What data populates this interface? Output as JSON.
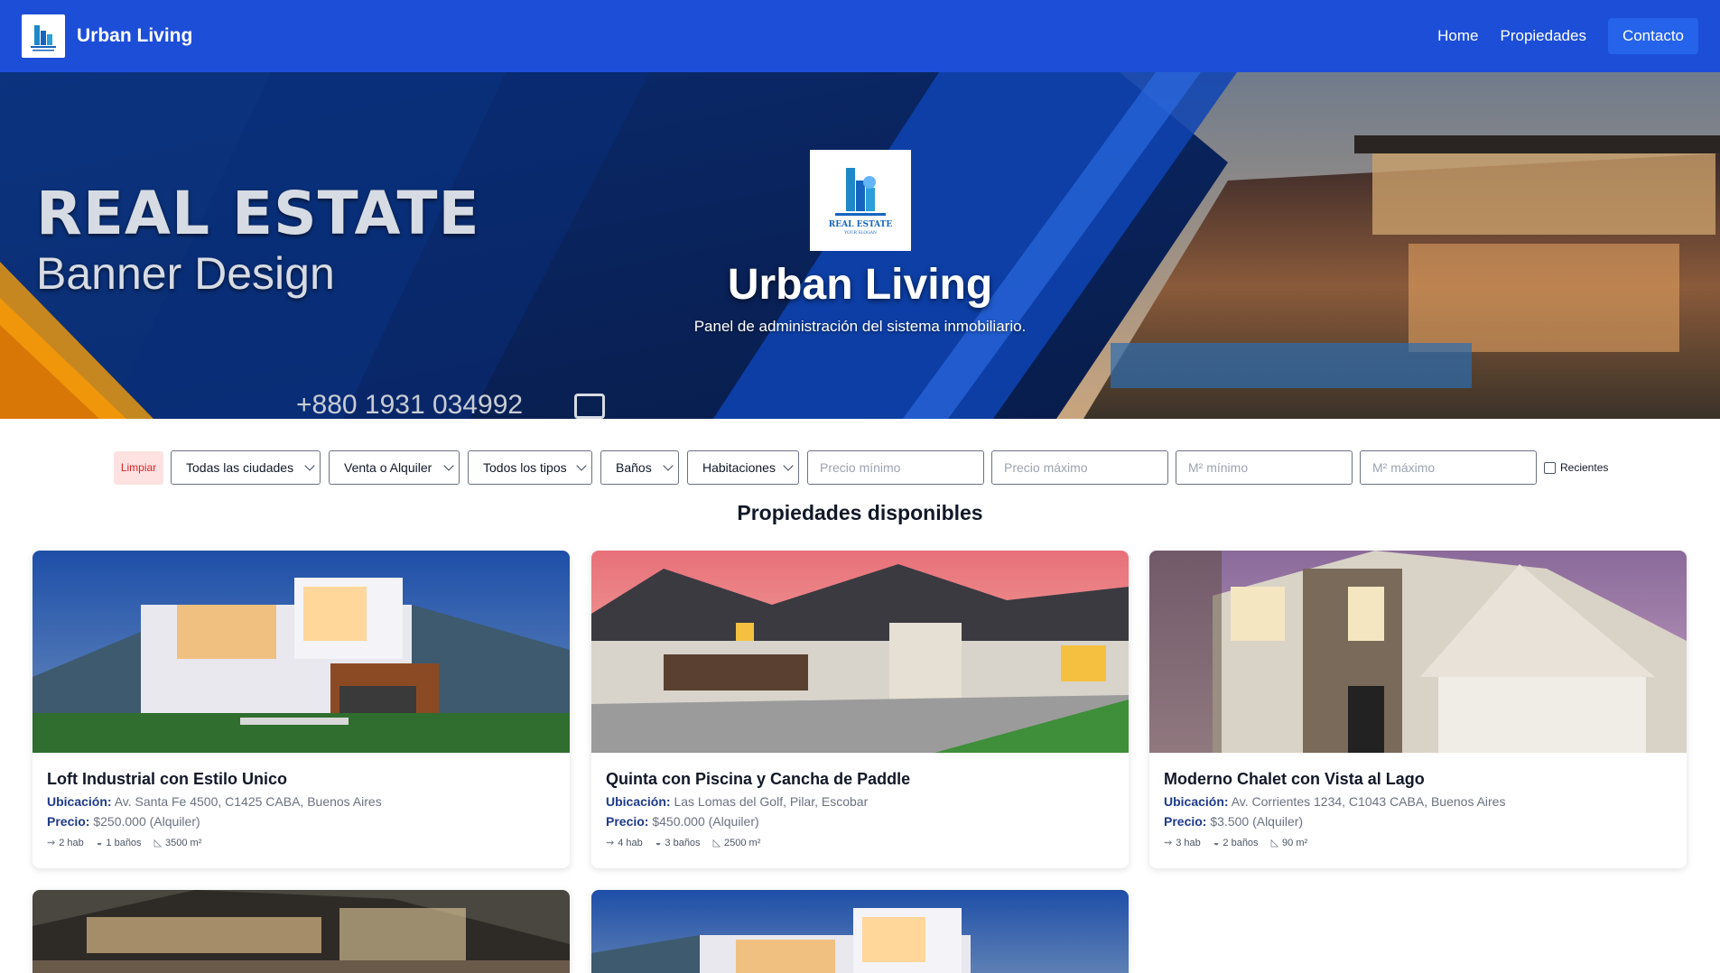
{
  "navbar": {
    "brand": "Urban Living",
    "links": [
      "Home",
      "Propiedades"
    ],
    "contact": "Contacto"
  },
  "hero": {
    "banner_heading": "REAL ESTATE",
    "banner_sub": "Banner Design",
    "banner_phone": "+880 1931 034992",
    "logo_text": "REAL ESTATE",
    "logo_slogan": "YOUR SLOGAN",
    "title": "Urban Living",
    "description": "Panel de administración del sistema inmobiliario."
  },
  "filters": {
    "clear": "Limpiar",
    "selects": [
      "Todas las ciudades",
      "Venta o Alquiler",
      "Todos los tipos",
      "Baños",
      "Habitaciones"
    ],
    "placeholders": [
      "Precio mínimo",
      "Precio máximo",
      "M² mínimo",
      "M² máximo"
    ],
    "recent": "Recientes"
  },
  "section_title": "Propiedades disponibles",
  "labels": {
    "location": "Ubicación:",
    "price": "Precio:"
  },
  "properties": [
    {
      "title": "Loft Industrial con Estilo Unico",
      "location": "Av. Santa Fe 4500, C1425 CABA, Buenos Aires",
      "price": "$250.000 (Alquiler)",
      "rooms": "2 hab",
      "baths": "1 baños",
      "area": "3500 m²"
    },
    {
      "title": "Quinta con Piscina y Cancha de Paddle",
      "location": "Las Lomas del Golf, Pilar, Escobar",
      "price": "$450.000 (Alquiler)",
      "rooms": "4 hab",
      "baths": "3 baños",
      "area": "2500 m²"
    },
    {
      "title": "Moderno Chalet con Vista al Lago",
      "location": "Av. Corrientes 1234, C1043 CABA, Buenos Aires",
      "price": "$3.500 (Alquiler)",
      "rooms": "3 hab",
      "baths": "2 baños",
      "area": "90 m²"
    }
  ],
  "colors": {
    "navbar": "#1d4ed8",
    "accent": "#2563eb",
    "label": "#1e3a8a",
    "clear_bg": "#fee2e2",
    "clear_text": "#dc2626"
  }
}
